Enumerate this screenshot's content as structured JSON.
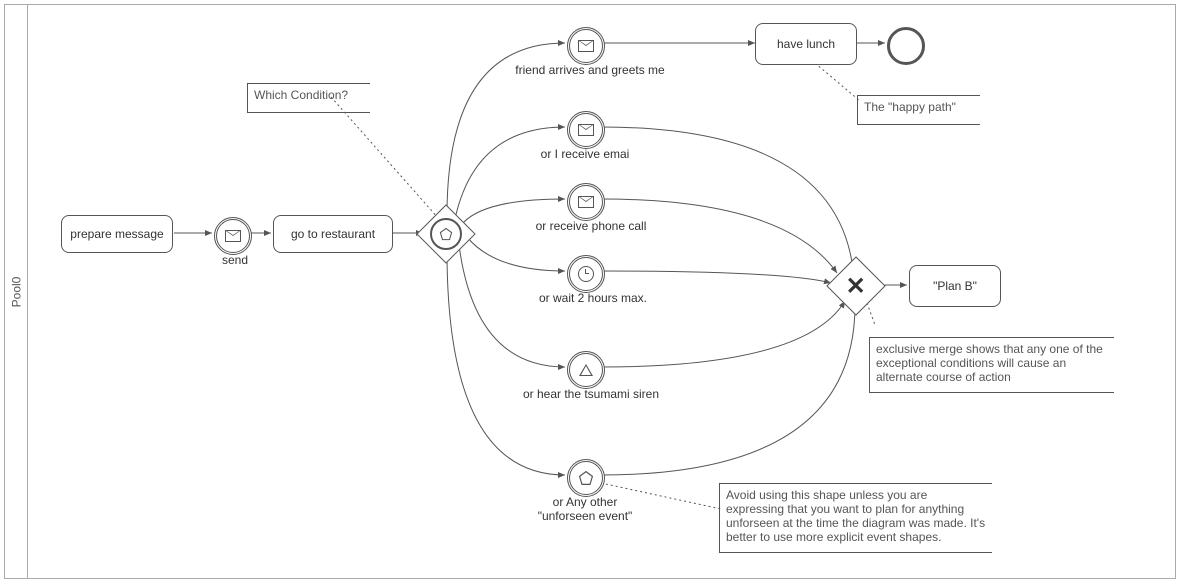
{
  "pool": {
    "label": "Pool0"
  },
  "tasks": {
    "prepare": "prepare message",
    "goto": "go to restaurant",
    "lunch": "have lunch",
    "planb": "\"Plan B\""
  },
  "events": {
    "send": "send",
    "friend": "friend arrives and greets me",
    "email": "or I receive emai",
    "phone": "or receive phone call",
    "wait": "or wait 2 hours max.",
    "siren": "or hear the tsumami siren",
    "other1": "or Any other",
    "other2": "\"unforseen event\""
  },
  "annotations": {
    "which": "Which Condition?",
    "happy": "The \"happy path\"",
    "merge": "exclusive merge shows that any one of the exceptional conditions will cause an alternate course of action",
    "avoid": "Avoid using this shape unless you are expressing that you want to plan for anything unforseen at the time the diagram was made. It's better to use more explicit event shapes."
  }
}
